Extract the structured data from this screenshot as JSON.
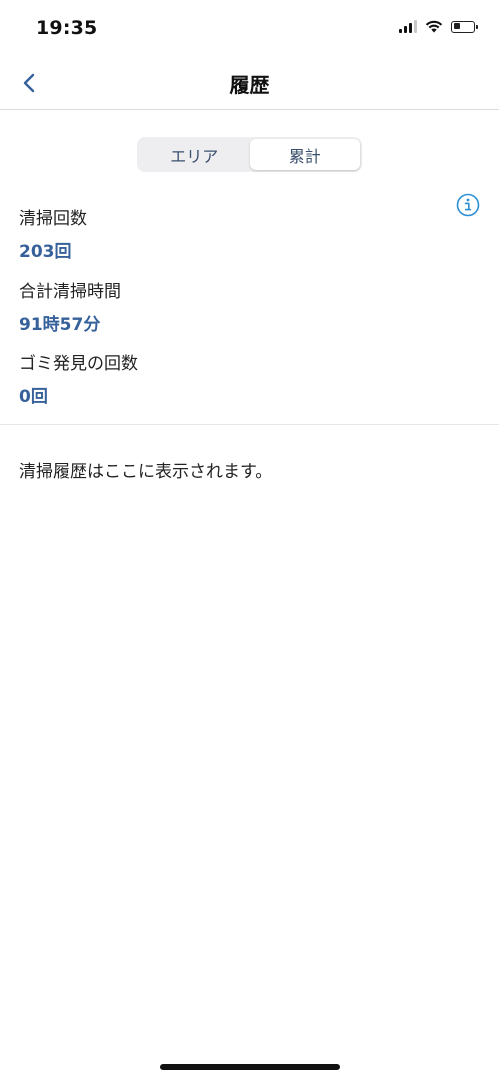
{
  "status_bar": {
    "time": "19:35",
    "icons": [
      "cellular-signal-icon",
      "wifi-icon",
      "battery-icon"
    ]
  },
  "nav": {
    "back_icon": "chevron-left-icon",
    "title": "履歴"
  },
  "segmented_control": {
    "segments": [
      "エリア",
      "累計"
    ],
    "selected": "累計"
  },
  "info_icon": "info-circle-icon",
  "stats": [
    {
      "label": "清掃回数",
      "value": "203回"
    },
    {
      "label": "合計清掃時間",
      "value": "91時57分"
    },
    {
      "label": "ゴミ発見の回数",
      "value": "0回"
    }
  ],
  "history": {
    "empty_message": "清掃履歴はここに表示されます。"
  },
  "colors": {
    "accent": "#36619a",
    "text": "#222222",
    "segment_background": "#eeeef0",
    "info_icon": "#2a8fd4"
  }
}
